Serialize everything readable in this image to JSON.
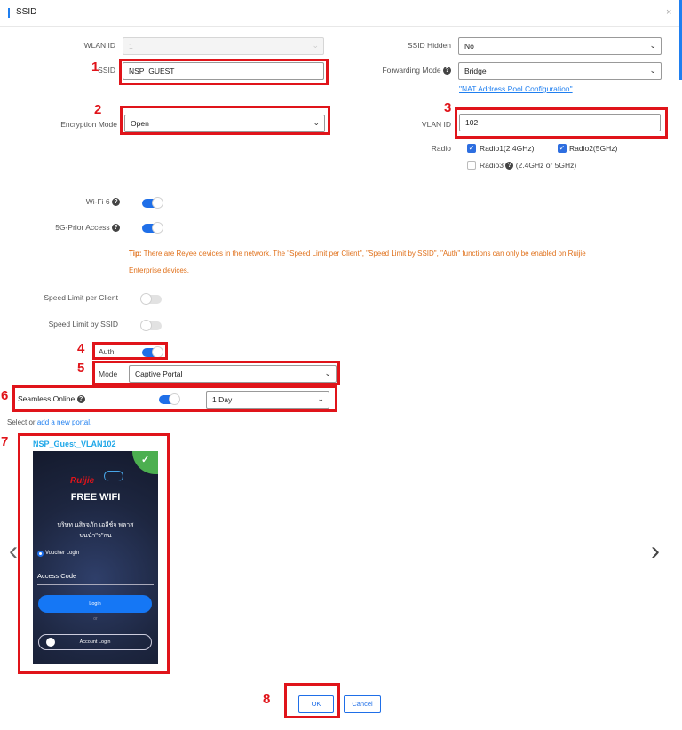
{
  "dialog": {
    "title": "SSID",
    "close_icon": "×"
  },
  "fields": {
    "wlan_id": {
      "label": "WLAN ID",
      "value": "1"
    },
    "ssid": {
      "label": "SSID",
      "value": "NSP_GUEST"
    },
    "encryption": {
      "label": "Encryption Mode",
      "value": "Open"
    },
    "ssid_hidden": {
      "label": "SSID Hidden",
      "value": "No"
    },
    "forwarding": {
      "label": "Forwarding Mode",
      "value": "Bridge",
      "link": "\"NAT Address Pool Configuration\""
    },
    "vlan_id": {
      "label": "VLAN ID",
      "value": "102"
    },
    "radio": {
      "label": "Radio",
      "options": [
        {
          "label": "Radio1(2.4GHz)",
          "checked": true
        },
        {
          "label": "Radio2(5GHz)",
          "checked": true
        },
        {
          "label": "Radio3",
          "suffix": "(2.4GHz or 5GHz)",
          "checked": false
        }
      ]
    },
    "wifi6": {
      "label": "Wi-Fi 6",
      "on": true
    },
    "prior5g": {
      "label": "5G-Prior Access",
      "on": true
    },
    "tip": {
      "prefix": "Tip:",
      "line1": "There are Reyee devices in the network. The \"Speed Limit per Client\", \"Speed Limit by SSID\", \"Auth\" functions can only be enabled on Ruijie",
      "line2": "Enterprise devices."
    },
    "speed_client": {
      "label": "Speed Limit per Client",
      "on": false
    },
    "speed_ssid": {
      "label": "Speed Limit by SSID",
      "on": false
    },
    "auth": {
      "label": "Auth",
      "on": true
    },
    "mode": {
      "label": "Mode",
      "value": "Captive Portal"
    },
    "seamless": {
      "label": "Seamless Online",
      "on": true,
      "duration": "1 Day"
    }
  },
  "portal_select": {
    "prefix": "Select or",
    "link": "add a new portal."
  },
  "portal": {
    "name": "NSP_Guest_VLAN102",
    "brand": "Ruijie",
    "headline": "FREE WIFI",
    "thai_line1": "บริษท นสิรจภัก เอลีช์จ พลาส",
    "thai_line2": "บนนำ\"จ\"กน",
    "voucher_label": "Voucher Login",
    "code_label": "Access Code",
    "login_btn": "Login",
    "or_text": "or",
    "account_btn": "Account Login",
    "prev_icon": "‹",
    "next_icon": "›"
  },
  "buttons": {
    "ok": "OK",
    "cancel": "Cancel"
  },
  "annotations": [
    "1",
    "2",
    "3",
    "4",
    "5",
    "6",
    "7",
    "8"
  ],
  "colors": {
    "accent": "#1f7ff0",
    "highlight": "#e0141a",
    "tip": "#e0701a",
    "toggle_on": "#1f6fe8",
    "check": "#4caf50"
  }
}
